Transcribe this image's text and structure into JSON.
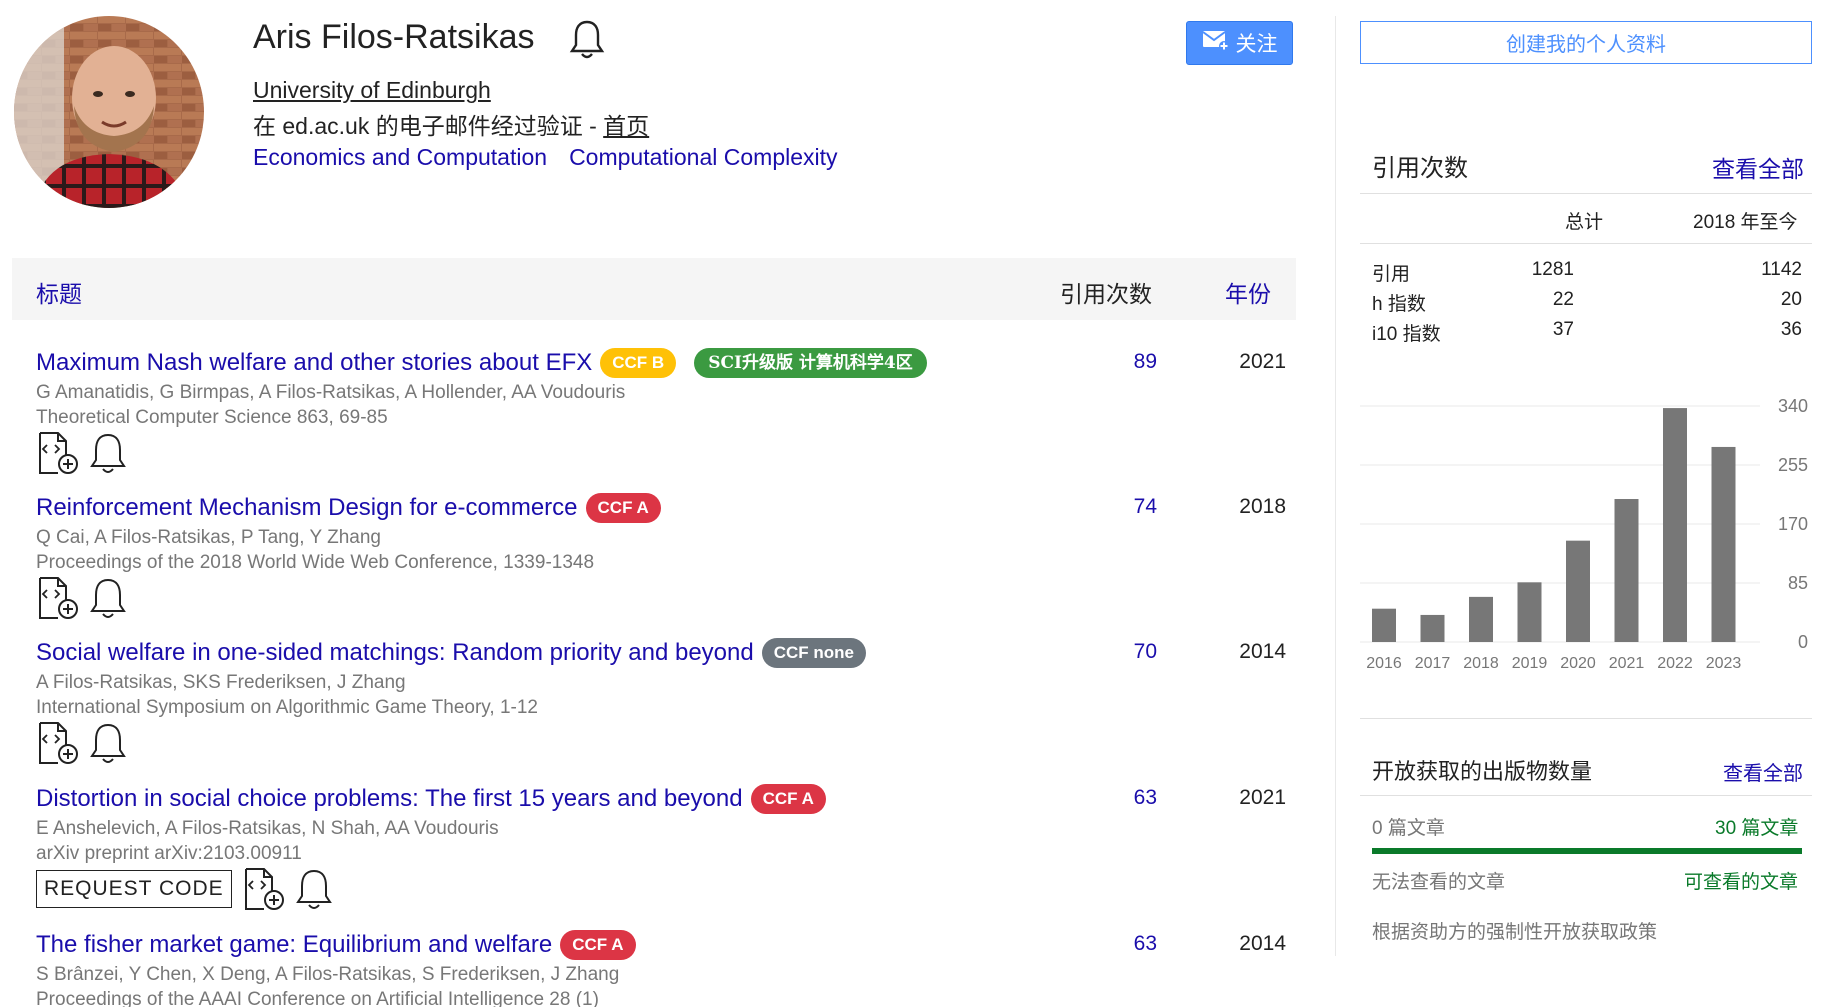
{
  "profile": {
    "name": "Aris Filos-Ratsikas",
    "affiliation": "University of Edinburgh",
    "verified_prefix": "在 ed.ac.uk 的电子邮件经过验证 - ",
    "homepage_label": "首页",
    "interests": [
      "Economics and Computation",
      "Computational Complexity"
    ],
    "follow_label": "关注"
  },
  "table": {
    "title_header": "标题",
    "cites_header": "引用次数",
    "year_header": "年份"
  },
  "publications": [
    {
      "title": "Maximum Nash welfare and other stories about EFX",
      "badge": "CCF B",
      "sci": "SCI升级版 计算机科学4区",
      "authors": "G Amanatidis, G Birmpas, A Filos-Ratsikas, A Hollender, AA Voudouris",
      "venue": "Theoretical Computer Science 863, 69-85",
      "cites": "89",
      "year": "2021"
    },
    {
      "title": "Reinforcement Mechanism Design for e-commerce",
      "badge": "CCF A",
      "authors": "Q Cai, A Filos-Ratsikas, P Tang, Y Zhang",
      "venue": "Proceedings of the 2018 World Wide Web Conference, 1339-1348",
      "cites": "74",
      "year": "2018"
    },
    {
      "title": "Social welfare in one-sided matchings: Random priority and beyond",
      "badge": "CCF none",
      "authors": "A Filos-Ratsikas, SKS Frederiksen, J Zhang",
      "venue": "International Symposium on Algorithmic Game Theory, 1-12",
      "cites": "70",
      "year": "2014"
    },
    {
      "title": "Distortion in social choice problems: The first 15 years and beyond",
      "badge": "CCF A",
      "authors": "E Anshelevich, A Filos-Ratsikas, N Shah, AA Voudouris",
      "venue": "arXiv preprint arXiv:2103.00911",
      "request_code": "REQUEST CODE",
      "cites": "63",
      "year": "2021"
    },
    {
      "title": "The fisher market game: Equilibrium and welfare",
      "badge": "CCF A",
      "authors": "S Brânzei, Y Chen, X Deng, A Filos-Ratsikas, S Frederiksen, J Zhang",
      "venue": "Proceedings of the AAAI Conference on Artificial Intelligence 28 (1)",
      "cites": "63",
      "year": "2014"
    }
  ],
  "sidebar": {
    "create_profile": "创建我的个人资料",
    "citations": {
      "title": "引用次数",
      "view_all": "查看全部",
      "col_total": "总计",
      "col_since": "2018 年至今",
      "rows": [
        {
          "label": "引用",
          "total": "1281",
          "since": "1142"
        },
        {
          "label": "h 指数",
          "total": "22",
          "since": "20"
        },
        {
          "label": "i10 指数",
          "total": "37",
          "since": "36"
        }
      ]
    },
    "open_access": {
      "title": "开放获取的出版物数量",
      "view_all": "查看全部",
      "left_count": "0 篇文章",
      "right_count": "30 篇文章",
      "left_label": "无法查看的文章",
      "right_label": "可查看的文章",
      "available_fraction": 1.0,
      "policy": "根据资助方的强制性开放获取政策"
    }
  },
  "chart_data": {
    "type": "bar",
    "categories": [
      "2016",
      "2017",
      "2018",
      "2019",
      "2020",
      "2021",
      "2022",
      "2023"
    ],
    "values": [
      48,
      39,
      65,
      86,
      146,
      206,
      337,
      281
    ],
    "yticks": [
      0,
      85,
      170,
      255,
      340
    ],
    "ylim": [
      0,
      340
    ],
    "bar_color": "#777777"
  },
  "colors": {
    "link": "#1a0dab",
    "ccf_a": "#dc3545",
    "ccf_b": "#ffc107",
    "ccf_none": "#6c757d",
    "sci": "#3b9a41",
    "oa_green": "#0a7a2a"
  }
}
